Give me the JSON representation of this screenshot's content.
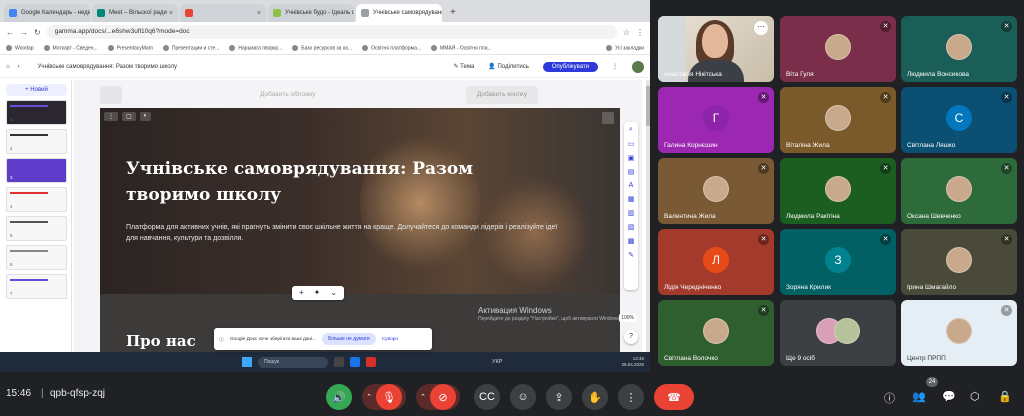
{
  "browser": {
    "tabs": [
      {
        "label": "Google Календарь - неделя",
        "color": "#4285f4",
        "active": false
      },
      {
        "label": "Meet – Вільскої ради",
        "color": "#00897b",
        "active": false
      },
      {
        "label": "",
        "color": "#ea4335",
        "active": false
      },
      {
        "label": "Учнівське будо - Ідеаль фо",
        "color": "#8bc34a",
        "active": false
      },
      {
        "label": "Учнівське самоврядування",
        "color": "#9aa0a6",
        "active": true
      }
    ],
    "new_tab": "+",
    "url": "gamma.app/docs/...e6shw3ufl10q6?mode=doc",
    "bookmarks": [
      "Woodap",
      "Моткарт - Сведен...",
      "PresentacyMam",
      "Презентации и сте...",
      "Нарьмага пворкр...",
      "Базо ресурсов за ка...",
      "Освітня платформа...",
      "ММАЯ - Освітня пла...",
      "Усі закладки"
    ]
  },
  "app": {
    "doc_title": "Учнівське самоврядування: Разом творимо школу",
    "theme_label": "Тема",
    "share_label": "Поділитись",
    "publish_label": "Опублікувати",
    "new_label": "+ Новий",
    "add_cover": "Добавить обложку",
    "add_button": "Добавить кнопку",
    "hero_title": "Учнівське самоврядування: Разом творимо школу",
    "hero_sub": "Платформа для активних учнів, які прагнуть змінити своє шкільне життя на краще. Долучайтеся до команди лідерів і реалізуйте ідеї для навчання, культури та дозвілля.",
    "about_title": "Про нас",
    "zoom": "100%",
    "help": "?",
    "toast_text": "Google Докс хоче зберігати ваші дані...",
    "toast_button": "Більше не думати",
    "toast_link": "Суворо",
    "watermark_1": "Активация Windows",
    "watermark_2": "Перейдите до розділу \"Настройки\", щоб активувати Windows.",
    "slide_numbers": [
      "1",
      "2",
      "3",
      "4",
      "5",
      "6",
      "7"
    ]
  },
  "taskbar": {
    "search": "Пошук",
    "lang": "УКР",
    "time": "13:46",
    "date": "25.04.2025"
  },
  "participants": [
    {
      "name": "Анастасія Нікітська",
      "type": "video",
      "bg": "#d8d2c8"
    },
    {
      "name": "Віта Гуля",
      "type": "photo",
      "bg": "#7a2e4a"
    },
    {
      "name": "Людмила Вонсикова",
      "type": "photo",
      "bg": "#1a5e57"
    },
    {
      "name": "Галина Корнєшин",
      "type": "letter",
      "letter": "Г",
      "bg": "#9c27b0",
      "circle": "#8e24aa"
    },
    {
      "name": "Віталіна Жила",
      "type": "photo",
      "bg": "#7a5a2a"
    },
    {
      "name": "Світлана Ляшко",
      "type": "letter",
      "letter": "С",
      "bg": "#0b4f72",
      "circle": "#0277bd"
    },
    {
      "name": "Валентина Жила",
      "type": "photo",
      "bg": "#7a5a34"
    },
    {
      "name": "Людмила Ракітіна",
      "type": "photo",
      "bg": "#1b5e20"
    },
    {
      "name": "Оксана Шевченко",
      "type": "photo",
      "bg": "#2e6b3a"
    },
    {
      "name": "Лідія Чередніченко",
      "type": "letter",
      "letter": "Л",
      "bg": "#a33a2c",
      "circle": "#e64a19"
    },
    {
      "name": "Зоряна Крилик",
      "type": "letter",
      "letter": "З",
      "bg": "#006064",
      "circle": "#00838f"
    },
    {
      "name": "Ірина Шмагайло",
      "type": "photo",
      "bg": "#4a4a3a"
    },
    {
      "name": "Світлана Волочко",
      "type": "photo",
      "bg": "#2f5e2f"
    },
    {
      "name": "Ще 9 осіб",
      "type": "group",
      "bg": "#3c4043"
    },
    {
      "name": "Центр ПРПП",
      "type": "photo",
      "bg": "#e5eef5"
    }
  ],
  "meeting": {
    "time": "15:46",
    "code": "qpb-qfsp-zqj",
    "participant_count": "24"
  }
}
